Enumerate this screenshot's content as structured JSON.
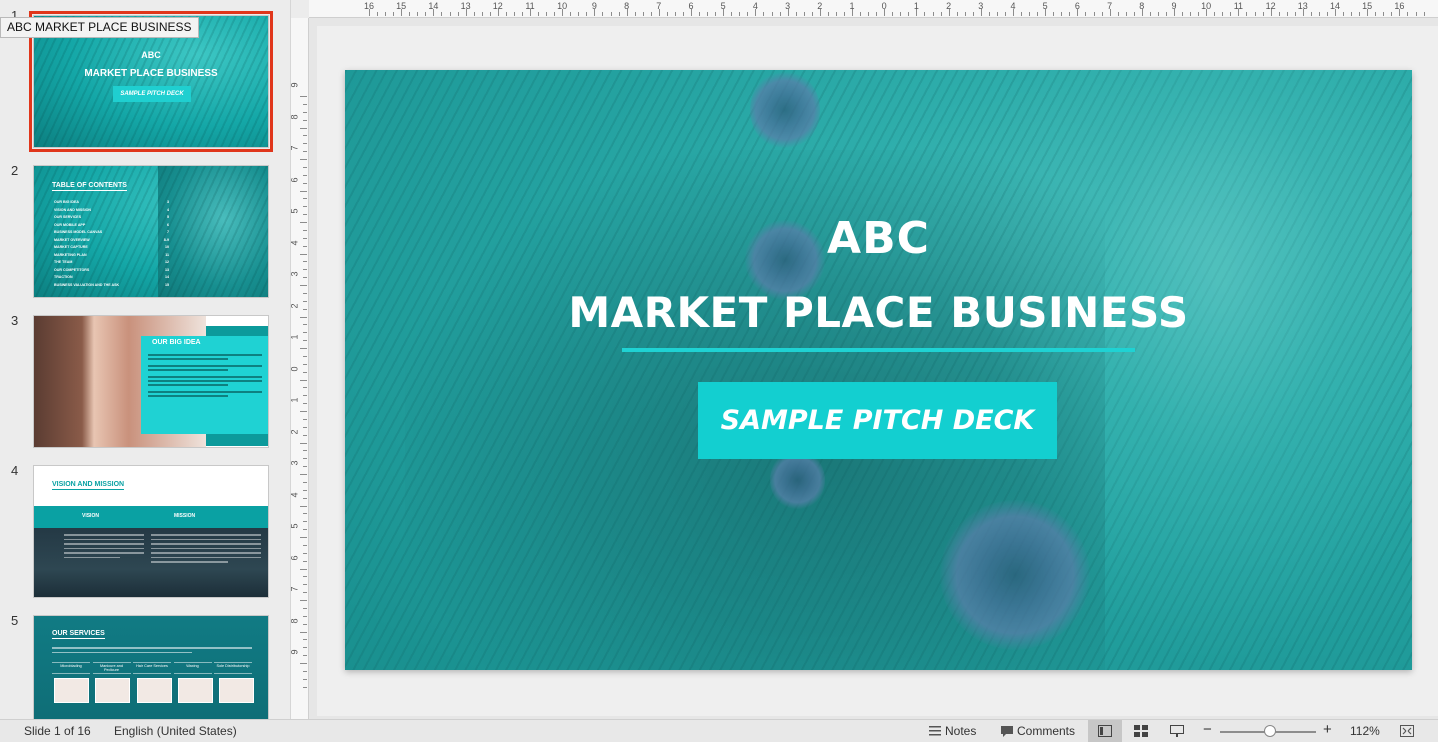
{
  "thumbnails": [
    {
      "number": "1",
      "tooltip": "ABC MARKET PLACE BUSINESS",
      "abc": "ABC",
      "title": "MARKET PLACE BUSINESS",
      "button": "SAMPLE PITCH DECK"
    },
    {
      "number": "2",
      "heading": "TABLE OF CONTENTS",
      "items": [
        {
          "label": "OUR BIG IDEA",
          "page": "3"
        },
        {
          "label": "VISION AND MISSION",
          "page": "4"
        },
        {
          "label": "OUR SERVICES",
          "page": "5"
        },
        {
          "label": "OUR MOBILE APP",
          "page": "6"
        },
        {
          "label": "BUSINESS MODEL CANVAS",
          "page": "7"
        },
        {
          "label": "MARKET OVERVIEW",
          "page": "8-9"
        },
        {
          "label": "MARKET CAPTURE",
          "page": "10"
        },
        {
          "label": "MARKETING PLAN",
          "page": "11"
        },
        {
          "label": "THE TEAM",
          "page": "12"
        },
        {
          "label": "OUR COMPETITORS",
          "page": "13"
        },
        {
          "label": "TRACTION",
          "page": "14"
        },
        {
          "label": "BUSINESS VALUATION AND THE ASK",
          "page": "15"
        }
      ]
    },
    {
      "number": "3",
      "heading": "OUR BIG IDEA"
    },
    {
      "number": "4",
      "heading": "VISION AND MISSION",
      "col1": "VISION",
      "col2": "MISSION"
    },
    {
      "number": "5",
      "heading": "OUR SERVICES",
      "categories": [
        "Microblading",
        "Manicure and Pedicure",
        "Hair Care Services",
        "Waxing",
        "Sole Distributorship"
      ]
    }
  ],
  "ruler": {
    "h_labels": [
      "16",
      "15",
      "14",
      "13",
      "12",
      "11",
      "10",
      "9",
      "8",
      "7",
      "6",
      "5",
      "4",
      "3",
      "2",
      "1",
      "0",
      "1",
      "2",
      "3",
      "4",
      "5",
      "6",
      "7",
      "8",
      "9",
      "10",
      "11",
      "12",
      "13",
      "14",
      "15",
      "16"
    ],
    "v_labels": [
      "9",
      "8",
      "7",
      "6",
      "5",
      "4",
      "3",
      "2",
      "1",
      "0",
      "1",
      "2",
      "3",
      "4",
      "5",
      "6",
      "7",
      "8",
      "9"
    ]
  },
  "slide": {
    "abc": "ABC",
    "title": "MARKET PLACE BUSINESS",
    "button": "SAMPLE PITCH DECK"
  },
  "status": {
    "slide_info": "Slide 1 of 16",
    "language": "English (United States)",
    "notes": "Notes",
    "comments": "Comments",
    "zoom": "112%"
  },
  "colors": {
    "accent": "#1fd2d3",
    "selection": "#e0361b"
  }
}
